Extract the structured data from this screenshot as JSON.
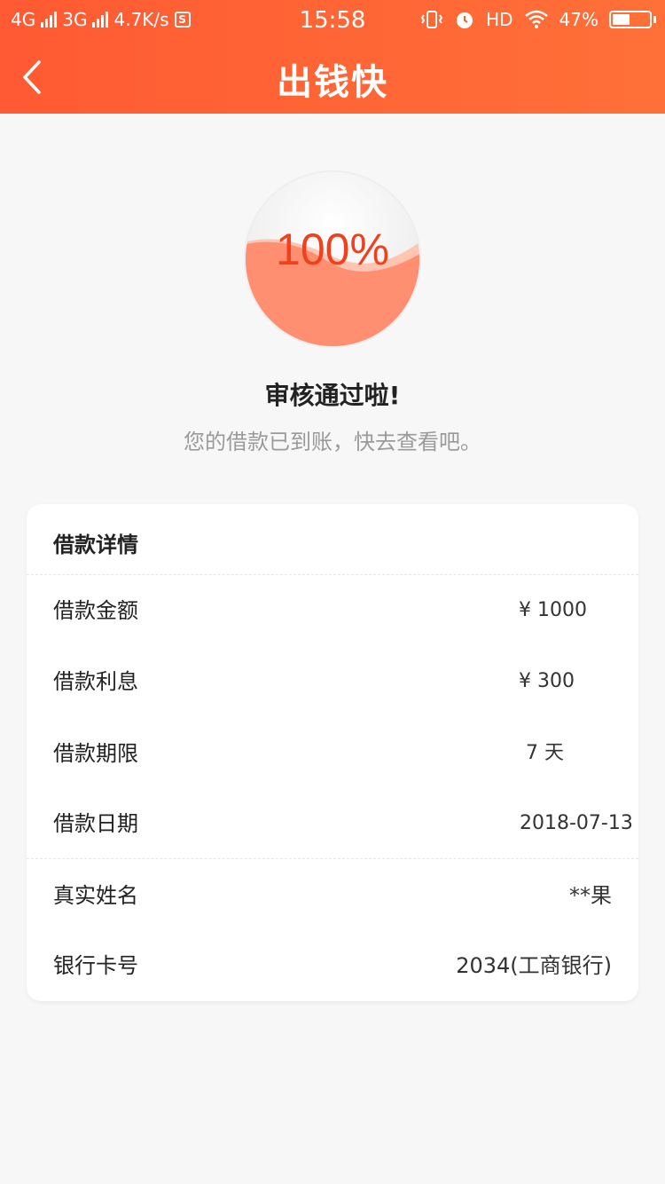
{
  "status_bar": {
    "network1": "4G",
    "network2": "3G",
    "speed": "4.7K/s",
    "app_badge": "S",
    "time": "15:58",
    "hd": "HD",
    "battery": "47%"
  },
  "nav": {
    "title": "出钱快"
  },
  "progress": {
    "percent_text": "100%",
    "value": 1.0,
    "fill_color": "#ff8f70"
  },
  "status": {
    "title": "审核通过啦!",
    "subtitle": "您的借款已到账，快去查看吧。"
  },
  "details": {
    "title": "借款详情",
    "rows": [
      {
        "label": "借款金额",
        "value": "¥  1000"
      },
      {
        "label": "借款利息",
        "value": "¥  300"
      },
      {
        "label": "借款期限",
        "value": "7 天"
      },
      {
        "label": "借款日期",
        "value": "2018-07-13"
      },
      {
        "label": "真实姓名",
        "value": "**果"
      },
      {
        "label": "银行卡号",
        "value": "2034(工商银行)"
      }
    ]
  },
  "colors": {
    "accent": "#ff5a33",
    "accent_end": "#ff7038",
    "percent_text": "#f0401c"
  }
}
